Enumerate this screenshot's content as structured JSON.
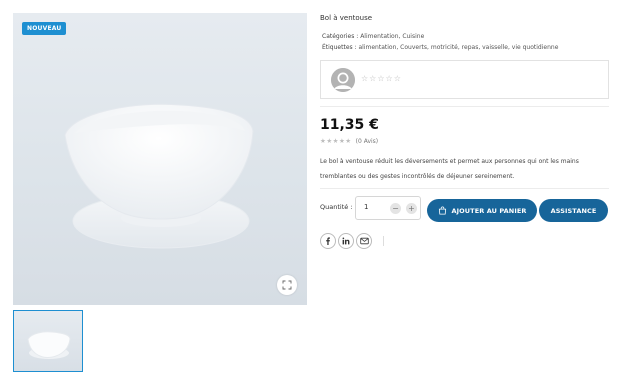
{
  "gallery": {
    "badge": "NOUVEAU",
    "zoom_icon": "expand-icon"
  },
  "product": {
    "title": "Bol à ventouse",
    "categories_label": "Catégories :",
    "categories": "Alimentation, Cuisine",
    "tags_label": "Étiquettes :",
    "tags": "alimentation, Couverts, motricité, repas, vaisselle, vie quotidienne",
    "review_box_stars": "☆☆☆☆☆",
    "price": "11,35 €",
    "rating_stars": "★★★★★",
    "rating_value": 0,
    "reviews_count": "(0 Avis)",
    "description": "Le bol à ventouse réduit les déversements et permet aux personnes qui ont les mains tremblantes ou des gestes incontrôlés de déjeuner sereinement."
  },
  "purchase": {
    "quantity_label": "Quantité :",
    "quantity_value": "1",
    "minus": "−",
    "plus": "+",
    "add_to_cart": "AJOUTER AU PANIER",
    "assistance": "ASSISTANCE"
  },
  "share": {
    "icons": [
      "facebook-icon",
      "linkedin-icon",
      "mail-icon"
    ]
  },
  "colors": {
    "accent": "#1e8fd1",
    "button": "#17659a"
  }
}
